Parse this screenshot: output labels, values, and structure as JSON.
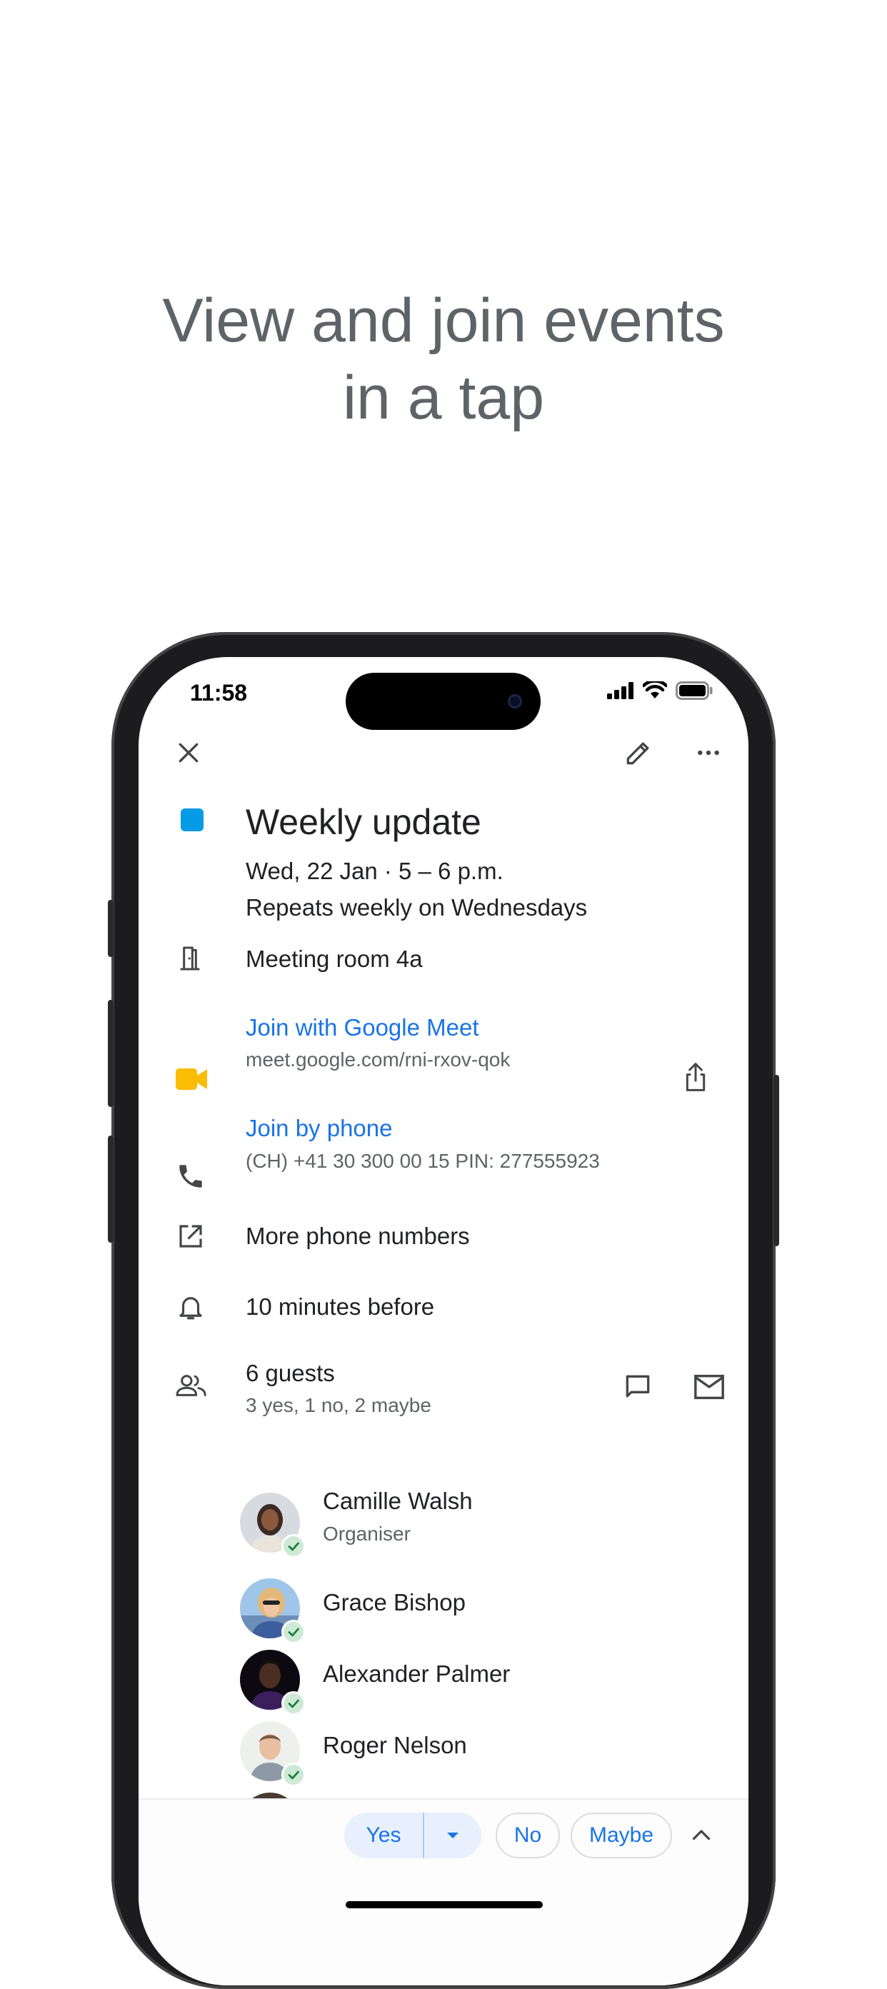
{
  "headline": {
    "line1": "View and join events",
    "line2": "in a tap"
  },
  "status_bar": {
    "time": "11:58"
  },
  "toolbar": {
    "close_icon": "close-icon",
    "edit_icon": "pencil-icon",
    "more_icon": "more-horizontal-icon"
  },
  "event": {
    "color": "#039be5",
    "title": "Weekly update",
    "datetime": "Wed, 22 Jan · 5 – 6 p.m.",
    "recurrence": "Repeats weekly on Wednesdays",
    "location": "Meeting room 4a",
    "meet": {
      "label": "Join with Google Meet",
      "url": "meet.google.com/rni-rxov-qok"
    },
    "phone": {
      "label": "Join by phone",
      "number": "(CH) +41 30 300 00 15 PIN: 277555923"
    },
    "more_numbers": "More phone numbers",
    "reminder": "10 minutes before",
    "guests": {
      "count_label": "6 guests",
      "summary": "3 yes, 1 no, 2 maybe",
      "list": [
        {
          "name": "Camille Walsh",
          "role": "Organiser"
        },
        {
          "name": "Grace Bishop",
          "role": ""
        },
        {
          "name": "Alexander Palmer",
          "role": ""
        },
        {
          "name": "Roger Nelson",
          "role": ""
        }
      ]
    }
  },
  "rsvp": {
    "yes": "Yes",
    "no": "No",
    "maybe": "Maybe"
  },
  "colors": {
    "accent": "#1a73e8",
    "meet_yellow": "#fbbc04",
    "text_primary": "#202124",
    "text_secondary": "#5f6368",
    "accept_green": "#188038"
  }
}
